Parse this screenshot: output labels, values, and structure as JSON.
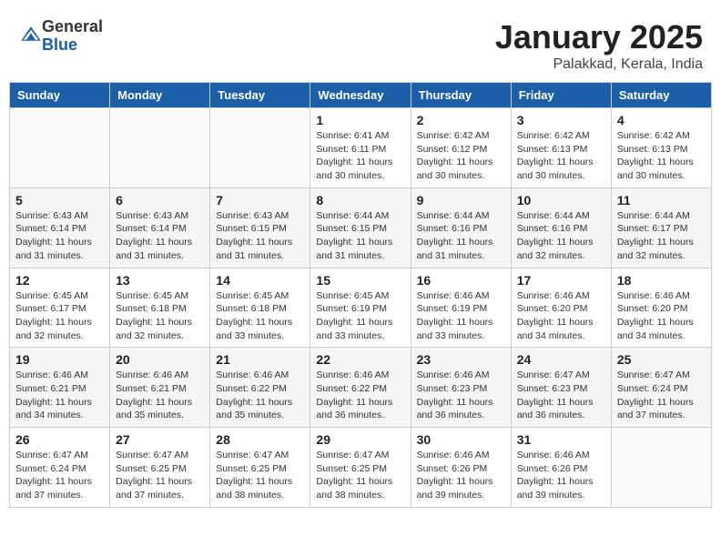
{
  "header": {
    "logo_general": "General",
    "logo_blue": "Blue",
    "month": "January 2025",
    "location": "Palakkad, Kerala, India"
  },
  "days_of_week": [
    "Sunday",
    "Monday",
    "Tuesday",
    "Wednesday",
    "Thursday",
    "Friday",
    "Saturday"
  ],
  "weeks": [
    [
      {
        "day": "",
        "info": ""
      },
      {
        "day": "",
        "info": ""
      },
      {
        "day": "",
        "info": ""
      },
      {
        "day": "1",
        "info": "Sunrise: 6:41 AM\nSunset: 6:11 PM\nDaylight: 11 hours\nand 30 minutes."
      },
      {
        "day": "2",
        "info": "Sunrise: 6:42 AM\nSunset: 6:12 PM\nDaylight: 11 hours\nand 30 minutes."
      },
      {
        "day": "3",
        "info": "Sunrise: 6:42 AM\nSunset: 6:13 PM\nDaylight: 11 hours\nand 30 minutes."
      },
      {
        "day": "4",
        "info": "Sunrise: 6:42 AM\nSunset: 6:13 PM\nDaylight: 11 hours\nand 30 minutes."
      }
    ],
    [
      {
        "day": "5",
        "info": "Sunrise: 6:43 AM\nSunset: 6:14 PM\nDaylight: 11 hours\nand 31 minutes."
      },
      {
        "day": "6",
        "info": "Sunrise: 6:43 AM\nSunset: 6:14 PM\nDaylight: 11 hours\nand 31 minutes."
      },
      {
        "day": "7",
        "info": "Sunrise: 6:43 AM\nSunset: 6:15 PM\nDaylight: 11 hours\nand 31 minutes."
      },
      {
        "day": "8",
        "info": "Sunrise: 6:44 AM\nSunset: 6:15 PM\nDaylight: 11 hours\nand 31 minutes."
      },
      {
        "day": "9",
        "info": "Sunrise: 6:44 AM\nSunset: 6:16 PM\nDaylight: 11 hours\nand 31 minutes."
      },
      {
        "day": "10",
        "info": "Sunrise: 6:44 AM\nSunset: 6:16 PM\nDaylight: 11 hours\nand 32 minutes."
      },
      {
        "day": "11",
        "info": "Sunrise: 6:44 AM\nSunset: 6:17 PM\nDaylight: 11 hours\nand 32 minutes."
      }
    ],
    [
      {
        "day": "12",
        "info": "Sunrise: 6:45 AM\nSunset: 6:17 PM\nDaylight: 11 hours\nand 32 minutes."
      },
      {
        "day": "13",
        "info": "Sunrise: 6:45 AM\nSunset: 6:18 PM\nDaylight: 11 hours\nand 32 minutes."
      },
      {
        "day": "14",
        "info": "Sunrise: 6:45 AM\nSunset: 6:18 PM\nDaylight: 11 hours\nand 33 minutes."
      },
      {
        "day": "15",
        "info": "Sunrise: 6:45 AM\nSunset: 6:19 PM\nDaylight: 11 hours\nand 33 minutes."
      },
      {
        "day": "16",
        "info": "Sunrise: 6:46 AM\nSunset: 6:19 PM\nDaylight: 11 hours\nand 33 minutes."
      },
      {
        "day": "17",
        "info": "Sunrise: 6:46 AM\nSunset: 6:20 PM\nDaylight: 11 hours\nand 34 minutes."
      },
      {
        "day": "18",
        "info": "Sunrise: 6:46 AM\nSunset: 6:20 PM\nDaylight: 11 hours\nand 34 minutes."
      }
    ],
    [
      {
        "day": "19",
        "info": "Sunrise: 6:46 AM\nSunset: 6:21 PM\nDaylight: 11 hours\nand 34 minutes."
      },
      {
        "day": "20",
        "info": "Sunrise: 6:46 AM\nSunset: 6:21 PM\nDaylight: 11 hours\nand 35 minutes."
      },
      {
        "day": "21",
        "info": "Sunrise: 6:46 AM\nSunset: 6:22 PM\nDaylight: 11 hours\nand 35 minutes."
      },
      {
        "day": "22",
        "info": "Sunrise: 6:46 AM\nSunset: 6:22 PM\nDaylight: 11 hours\nand 36 minutes."
      },
      {
        "day": "23",
        "info": "Sunrise: 6:46 AM\nSunset: 6:23 PM\nDaylight: 11 hours\nand 36 minutes."
      },
      {
        "day": "24",
        "info": "Sunrise: 6:47 AM\nSunset: 6:23 PM\nDaylight: 11 hours\nand 36 minutes."
      },
      {
        "day": "25",
        "info": "Sunrise: 6:47 AM\nSunset: 6:24 PM\nDaylight: 11 hours\nand 37 minutes."
      }
    ],
    [
      {
        "day": "26",
        "info": "Sunrise: 6:47 AM\nSunset: 6:24 PM\nDaylight: 11 hours\nand 37 minutes."
      },
      {
        "day": "27",
        "info": "Sunrise: 6:47 AM\nSunset: 6:25 PM\nDaylight: 11 hours\nand 37 minutes."
      },
      {
        "day": "28",
        "info": "Sunrise: 6:47 AM\nSunset: 6:25 PM\nDaylight: 11 hours\nand 38 minutes."
      },
      {
        "day": "29",
        "info": "Sunrise: 6:47 AM\nSunset: 6:25 PM\nDaylight: 11 hours\nand 38 minutes."
      },
      {
        "day": "30",
        "info": "Sunrise: 6:46 AM\nSunset: 6:26 PM\nDaylight: 11 hours\nand 39 minutes."
      },
      {
        "day": "31",
        "info": "Sunrise: 6:46 AM\nSunset: 6:26 PM\nDaylight: 11 hours\nand 39 minutes."
      },
      {
        "day": "",
        "info": ""
      }
    ]
  ]
}
